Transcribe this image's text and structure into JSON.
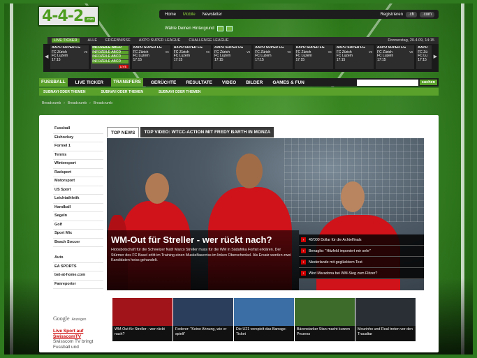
{
  "logo": {
    "text": "4-4-2",
    "suffix": ".com"
  },
  "topnav": {
    "items": [
      "Home",
      "Mobile",
      "Newsletter"
    ],
    "active": "Mobile",
    "right": {
      "label": "Registrieren",
      "pills": [
        ".ch",
        ".com"
      ]
    }
  },
  "hint": {
    "text": "Wähle Deinen Hintergrund"
  },
  "tickbar": {
    "items": [
      "Live Ticker",
      "Alle",
      "Ergebnisse",
      "AXPO Super League",
      "Challenge League"
    ],
    "date": "Donnerstag, 20.4.09, 14:15"
  },
  "ticker": {
    "matches": [
      {
        "league": "AXPO SUPER LG",
        "home": "FC Zürich",
        "away": "FC Luzern",
        "time": "17:15",
        "highlight": false
      },
      {
        "league": "INFOZEILE ABCD",
        "home": "INFOZEILE ABCD",
        "away": "INFOZEILE ABCD",
        "time": "INFOZEILE ABCD",
        "highlight": true,
        "live": "LIVE"
      },
      {
        "league": "AXPO SUPER LG",
        "home": "FC Zürich",
        "away": "FC Luzern",
        "time": "17:15",
        "highlight": false
      },
      {
        "league": "AXPO SUPER LG",
        "home": "FC Zürich",
        "away": "FC Luzern",
        "time": "17:15",
        "highlight": false
      },
      {
        "league": "AXPO SUPER LG",
        "home": "FC Zürich",
        "away": "FC Luzern",
        "time": "17:15",
        "highlight": false
      },
      {
        "league": "AXPO SUPER LG",
        "home": "FC Zürich",
        "away": "FC Luzern",
        "time": "17:15",
        "highlight": false
      },
      {
        "league": "AXPO SUPER LG",
        "home": "FC Zürich",
        "away": "FC Luzern",
        "time": "17:15",
        "highlight": false
      },
      {
        "league": "AXPO SUPER LG",
        "home": "FC Zürich",
        "away": "FC Luzern",
        "time": "17:15",
        "highlight": false
      },
      {
        "league": "AXPO SUPER LG",
        "home": "FC Zürich",
        "away": "FC Luzern",
        "time": "17:15",
        "highlight": false
      },
      {
        "league": "AXPO",
        "home": "FC Zü",
        "away": "FC Lu",
        "time": "17:15",
        "highlight": false
      }
    ]
  },
  "mainnav": {
    "items": [
      "Fussball",
      "Live Ticker",
      "Transfers",
      "Gerüchte",
      "Resultate",
      "Video",
      "Bilder",
      "Games & Fun"
    ],
    "active": "Transfers",
    "search_button": "suchen"
  },
  "subnav": {
    "items": [
      "Subnavi oder Themen",
      "Subnavi oder Themen",
      "Subnavi oder Themen"
    ]
  },
  "crumb": {
    "items": [
      "Breadcrumb",
      "Breadcrumb",
      "Breadcrumb"
    ]
  },
  "sidebar": {
    "group1": [
      "Fussball",
      "Eishockey",
      "Formel 1",
      "Tennis",
      "Wintersport",
      "Radsport",
      "Motorsport",
      "US Sport",
      "Leichtathletik",
      "Handball",
      "Segeln",
      "Golf",
      "Sport Mix",
      "Beach Soccer"
    ],
    "group2": [
      "Auto",
      "EA SPORTS",
      "bet-at-home.com",
      "Fanreporter"
    ]
  },
  "google": {
    "g": "Google",
    "a": "Anzeigen"
  },
  "swiss": {
    "title": "Live Sport auf SwisscomTV",
    "desc": "Swisscom TV bringt Fussball und"
  },
  "tabs": [
    "Top News",
    "Top Video: WTCC-Action mit Fredy Barth in Monza"
  ],
  "hero": {
    "title": "WM-Out für Streller - wer rückt nach?",
    "text": "Hiobsbotschaft für die Schweizer Nati! Marco Streller muss für die WM in Südafrika Forfait erklären. Der Stürmer des FC Basel erlitt im Training einen Muskelfaserriss im linken Oberschenkel. Als Ersatz werden zwei Kandidaten heiss gehandelt.",
    "links": [
      "45'000 Dollar für die Achtelfinals",
      "Benaglio: \"Hitzfeld imponiert mir sehr\"",
      "Niederlande mit geglücktem Test",
      "Wird Maradona bei WM-Sieg zum Flitzer?"
    ]
  },
  "thumbs": [
    {
      "caption": "WM-Out für Streller - wer rückt nach?",
      "color": "#a0141a"
    },
    {
      "caption": "Federer: \"Keine Ahnung, wie er spielt\"",
      "color": "#2b3e5c"
    },
    {
      "caption": "Die U21 verspielt das Barrage-Ticket",
      "color": "#3b6ea5"
    },
    {
      "caption": "Bärenstarker Stan macht kurzen Prozess",
      "color": "#3d6b2a"
    },
    {
      "caption": "Mourinho und Real treten vor den Traualtar",
      "color": "#2a2f36"
    }
  ]
}
